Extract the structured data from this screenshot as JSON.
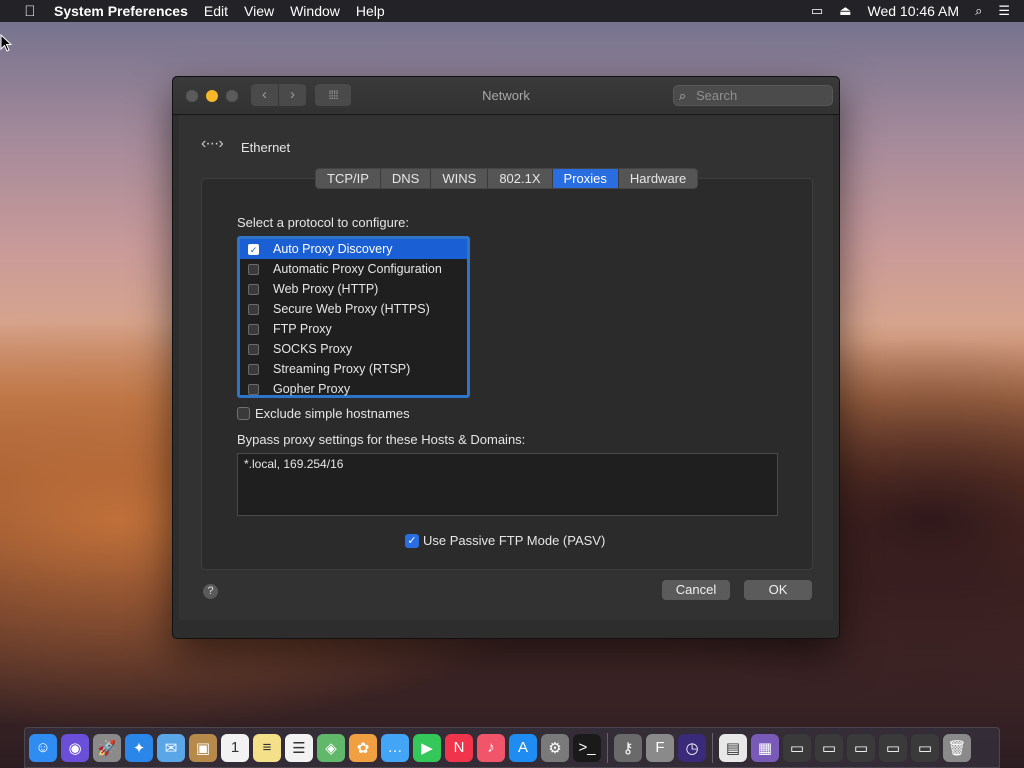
{
  "menubar": {
    "app": "System Preferences",
    "items": [
      "Edit",
      "View",
      "Window",
      "Help"
    ],
    "clock": "Wed 10:46 AM"
  },
  "window": {
    "title": "Network",
    "search_placeholder": "Search",
    "interface": "Ethernet",
    "tabs": [
      {
        "label": "TCP/IP",
        "active": false
      },
      {
        "label": "DNS",
        "active": false
      },
      {
        "label": "WINS",
        "active": false
      },
      {
        "label": "802.1X",
        "active": false
      },
      {
        "label": "Proxies",
        "active": true
      },
      {
        "label": "Hardware",
        "active": false
      }
    ],
    "protocol_label": "Select a protocol to configure:",
    "protocols": [
      {
        "label": "Auto Proxy Discovery",
        "checked": true,
        "selected": true
      },
      {
        "label": "Automatic Proxy Configuration",
        "checked": false,
        "selected": false
      },
      {
        "label": "Web Proxy (HTTP)",
        "checked": false,
        "selected": false
      },
      {
        "label": "Secure Web Proxy (HTTPS)",
        "checked": false,
        "selected": false
      },
      {
        "label": "FTP Proxy",
        "checked": false,
        "selected": false
      },
      {
        "label": "SOCKS Proxy",
        "checked": false,
        "selected": false
      },
      {
        "label": "Streaming Proxy (RTSP)",
        "checked": false,
        "selected": false
      },
      {
        "label": "Gopher Proxy",
        "checked": false,
        "selected": false
      }
    ],
    "exclude_label": "Exclude simple hostnames",
    "exclude_checked": false,
    "bypass_label": "Bypass proxy settings for these Hosts & Domains:",
    "bypass_value": "*.local, 169.254/16",
    "pasv_label": "Use Passive FTP Mode (PASV)",
    "pasv_checked": true,
    "cancel_label": "Cancel",
    "ok_label": "OK",
    "help_label": "?"
  },
  "dock": {
    "apps": [
      {
        "name": "finder-icon",
        "glyph": "☺",
        "color": "#2f8cf0"
      },
      {
        "name": "siri-icon",
        "glyph": "◉",
        "color": "#6b4fd8"
      },
      {
        "name": "launchpad-icon",
        "glyph": "🚀",
        "color": "#8a8a8a"
      },
      {
        "name": "safari-icon",
        "glyph": "✦",
        "color": "#2a86e8"
      },
      {
        "name": "mail-icon",
        "glyph": "✉",
        "color": "#5aa6e6"
      },
      {
        "name": "contacts-icon",
        "glyph": "▣",
        "color": "#b58a4a"
      },
      {
        "name": "calendar-icon",
        "glyph": "1",
        "color": "#f2f2f2"
      },
      {
        "name": "notes-icon",
        "glyph": "≡",
        "color": "#f5e08a"
      },
      {
        "name": "reminders-icon",
        "glyph": "☰",
        "color": "#f2f2f2"
      },
      {
        "name": "maps-icon",
        "glyph": "◈",
        "color": "#62b86a"
      },
      {
        "name": "photos-icon",
        "glyph": "✿",
        "color": "#f0a040"
      },
      {
        "name": "messages-icon",
        "glyph": "…",
        "color": "#42a5f5"
      },
      {
        "name": "facetime-icon",
        "glyph": "▶",
        "color": "#34c759"
      },
      {
        "name": "news-icon",
        "glyph": "N",
        "color": "#f0344c"
      },
      {
        "name": "music-icon",
        "glyph": "♪",
        "color": "#f0556a"
      },
      {
        "name": "appstore-icon",
        "glyph": "A",
        "color": "#1e8cf0"
      },
      {
        "name": "system-preferences-icon",
        "glyph": "⚙",
        "color": "#7a7a7a"
      },
      {
        "name": "terminal-icon",
        "glyph": ">_",
        "color": "#1a1a1a"
      },
      {
        "name": "keychain-icon",
        "glyph": "⚷",
        "color": "#6a6a6a"
      },
      {
        "name": "font-book-icon",
        "glyph": "F",
        "color": "#8a8a8a"
      },
      {
        "name": "time-machine-icon",
        "glyph": "◷",
        "color": "#3a2a7a"
      },
      {
        "name": "document-icon",
        "glyph": "▤",
        "color": "#e8e8e8"
      },
      {
        "name": "screenshot-icon",
        "glyph": "▦",
        "color": "#7a5ab8"
      },
      {
        "name": "window-thumb-1-icon",
        "glyph": "▭",
        "color": "#3a3a3a"
      },
      {
        "name": "window-thumb-2-icon",
        "glyph": "▭",
        "color": "#3a3a3a"
      },
      {
        "name": "window-thumb-3-icon",
        "glyph": "▭",
        "color": "#3a3a3a"
      },
      {
        "name": "window-thumb-4-icon",
        "glyph": "▭",
        "color": "#3a3a3a"
      },
      {
        "name": "window-thumb-5-icon",
        "glyph": "▭",
        "color": "#3a3a3a"
      },
      {
        "name": "trash-icon",
        "glyph": "🗑",
        "color": "#8a8a8a"
      }
    ]
  }
}
